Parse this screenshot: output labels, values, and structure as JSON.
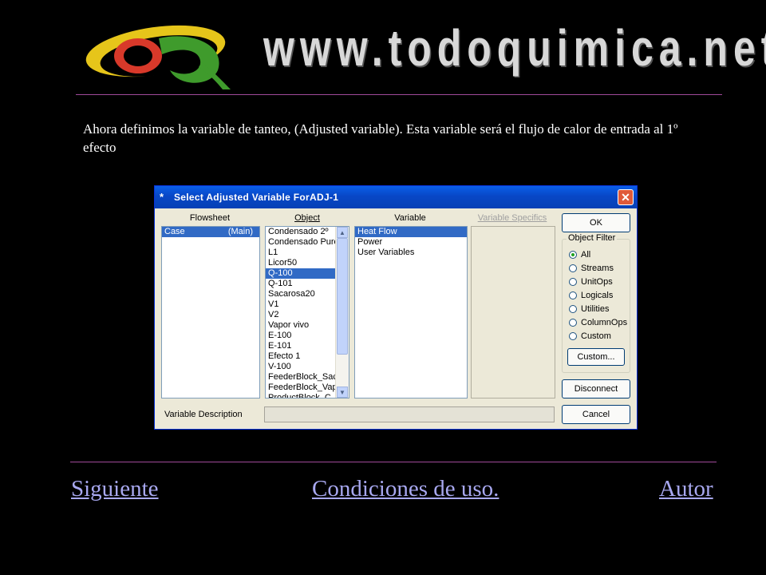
{
  "header": {
    "site_url": "www.todoquimica.net"
  },
  "intro_text": "Ahora definimos la variable de tanteo, (Adjusted variable). Esta variable será el flujo de calor de entrada al 1º efecto",
  "dialog": {
    "title": "Select Adjusted Variable ForADJ-1",
    "title_icon": "*",
    "close_label": "✕",
    "columns": {
      "flowsheet": "Flowsheet",
      "object": "Object",
      "variable": "Variable",
      "variable_specifics": "Variable Specifics"
    },
    "flowsheet_items": [
      {
        "name": "Case",
        "tag": "(Main)",
        "selected": true
      }
    ],
    "object_items": [
      {
        "label": "Condensado 2º",
        "selected": false
      },
      {
        "label": "Condensado Puro",
        "selected": false
      },
      {
        "label": "L1",
        "selected": false
      },
      {
        "label": "Licor50",
        "selected": false
      },
      {
        "label": "Q-100",
        "selected": true
      },
      {
        "label": "Q-101",
        "selected": false
      },
      {
        "label": "Sacarosa20",
        "selected": false
      },
      {
        "label": "V1",
        "selected": false
      },
      {
        "label": "V2",
        "selected": false
      },
      {
        "label": "Vapor vivo",
        "selected": false
      },
      {
        "label": "E-100",
        "selected": false
      },
      {
        "label": "E-101",
        "selected": false
      },
      {
        "label": "Efecto 1",
        "selected": false
      },
      {
        "label": "V-100",
        "selected": false
      },
      {
        "label": "FeederBlock_Sacarosa",
        "selected": false
      },
      {
        "label": "FeederBlock_Vapor",
        "selected": false
      },
      {
        "label": "ProductBlock_C",
        "selected": false
      }
    ],
    "variable_items": [
      {
        "label": "Heat Flow",
        "selected": true
      },
      {
        "label": "Power",
        "selected": false
      },
      {
        "label": "User Variables",
        "selected": false
      }
    ],
    "buttons": {
      "ok": "OK",
      "custom": "Custom...",
      "disconnect": "Disconnect",
      "cancel": "Cancel"
    },
    "object_filter": {
      "legend": "Object Filter",
      "options": [
        {
          "label": "All",
          "checked": true
        },
        {
          "label": "Streams",
          "checked": false
        },
        {
          "label": "UnitOps",
          "checked": false
        },
        {
          "label": "Logicals",
          "checked": false
        },
        {
          "label": "Utilities",
          "checked": false
        },
        {
          "label": "ColumnOps",
          "checked": false
        },
        {
          "label": "Custom",
          "checked": false
        }
      ]
    },
    "variable_description_label": "Variable Description",
    "variable_description_value": ""
  },
  "nav": {
    "next": "Siguiente",
    "terms": "Condiciones de uso.",
    "author": "Autor"
  },
  "colors": {
    "background": "#000000",
    "link": "#a8a8f0",
    "divider": "#a04a9a",
    "selection": "#316ac5",
    "titlebar": "#0847c6"
  }
}
